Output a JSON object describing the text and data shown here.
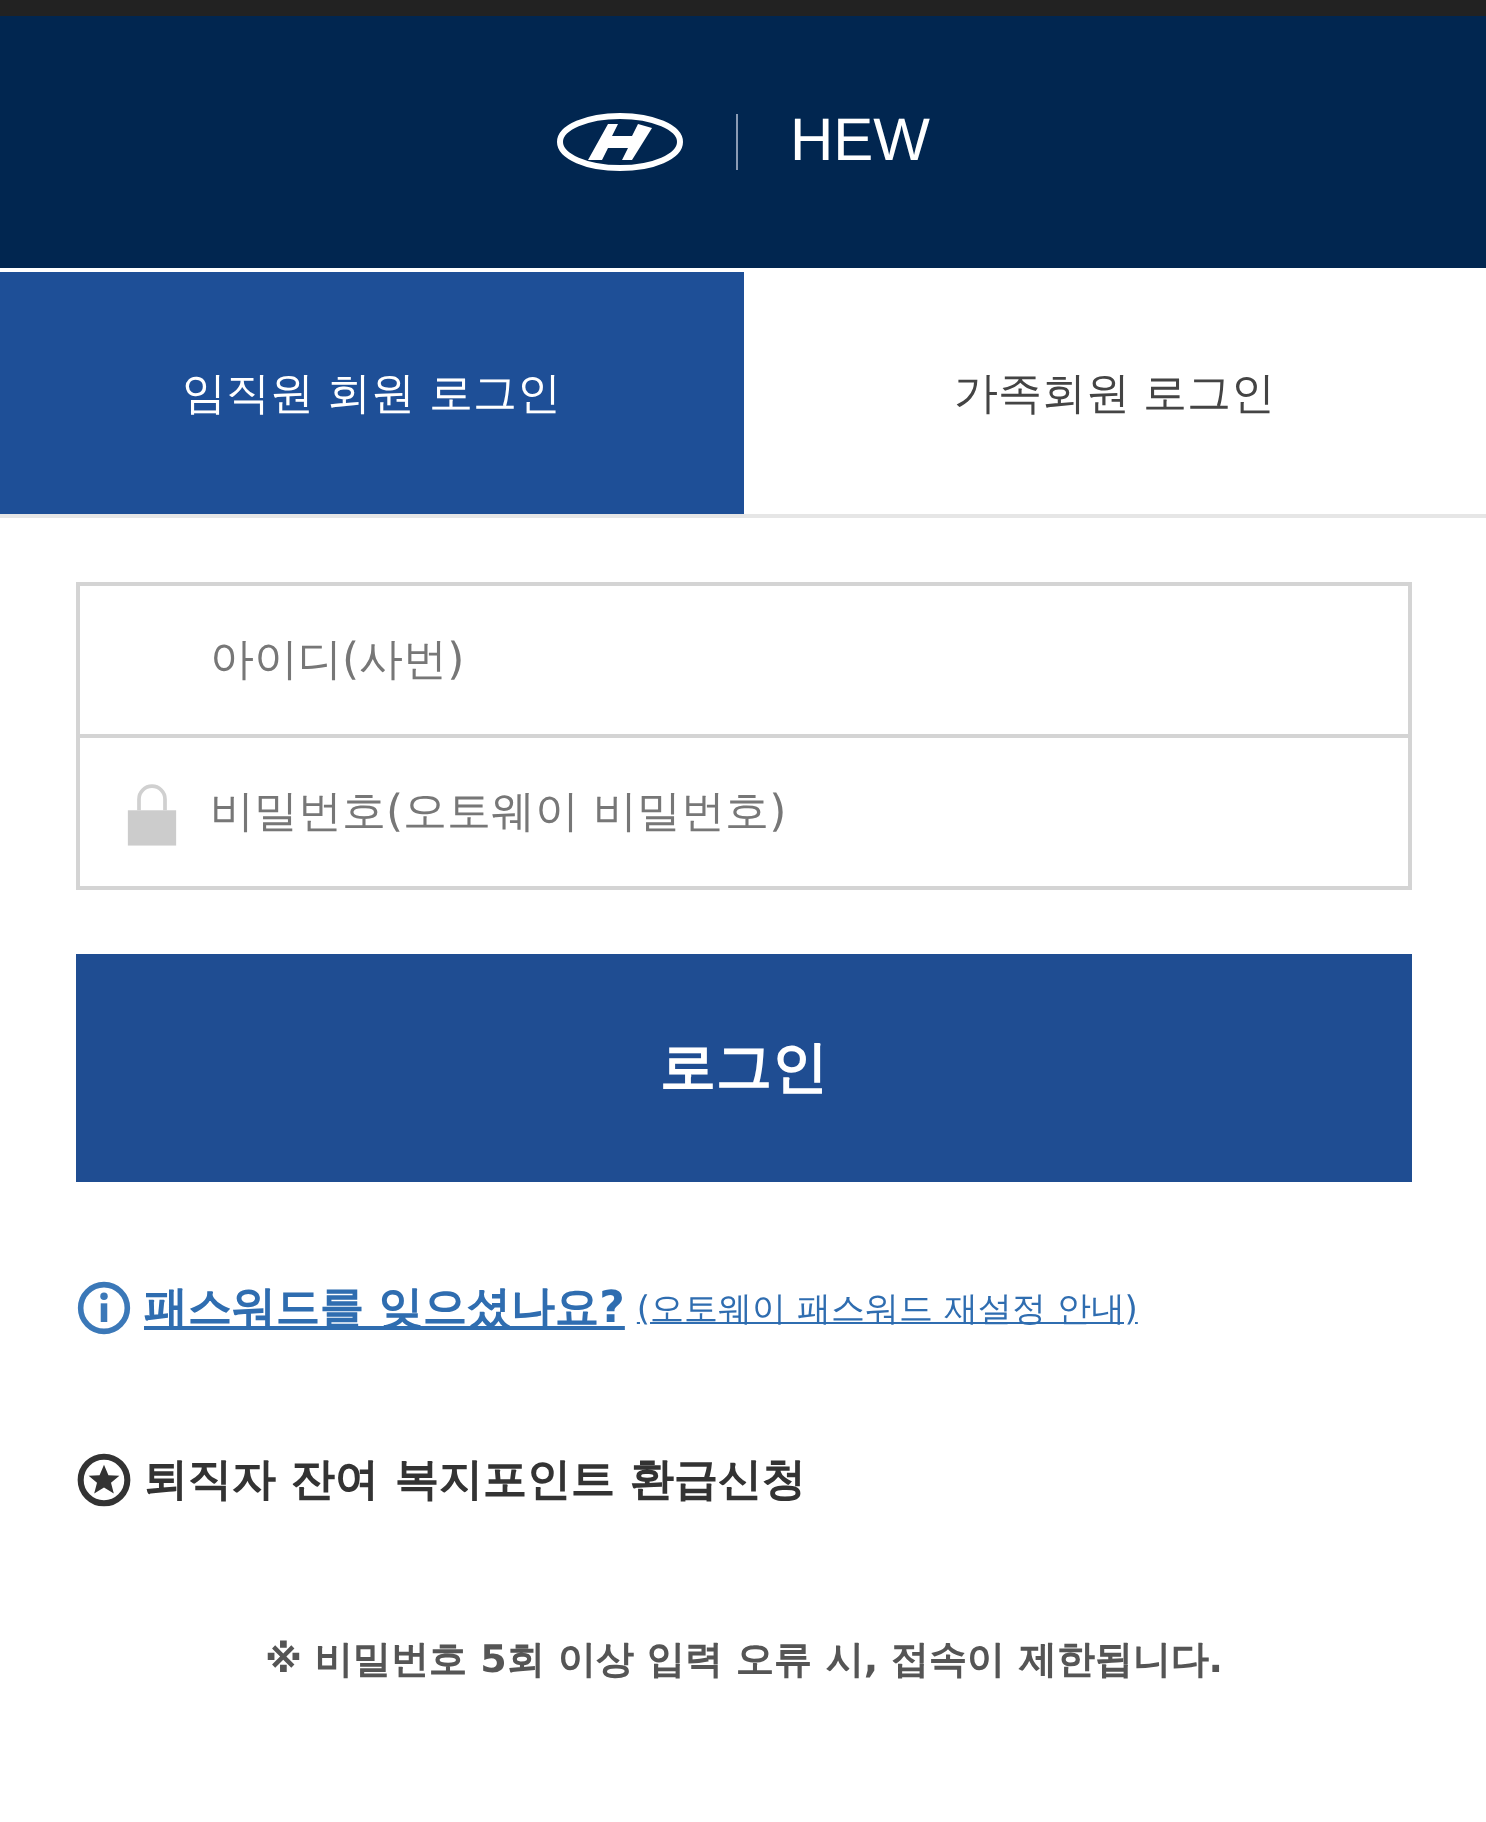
{
  "header": {
    "brand": "HEW"
  },
  "tabs": [
    {
      "label": "임직원 회원 로그인",
      "selected": true
    },
    {
      "label": "가족회원 로그인",
      "selected": false
    }
  ],
  "fields": [
    {
      "kind": "id",
      "placeholder": "아이디(사번)"
    },
    {
      "kind": "password",
      "placeholder": "비밀번호(오토웨이 비밀번호)"
    }
  ],
  "login_button": "로그인",
  "help": {
    "question": "패스워드를 잊으셨나요?",
    "guide": "(오토웨이 패스워드 재설정 안내)"
  },
  "refund_link": "퇴직자 잔여 복지포인트 환급신청",
  "notice": "※ 비밀번호 5회 이상 입력 오류 시, 접속이 제한됩니다."
}
